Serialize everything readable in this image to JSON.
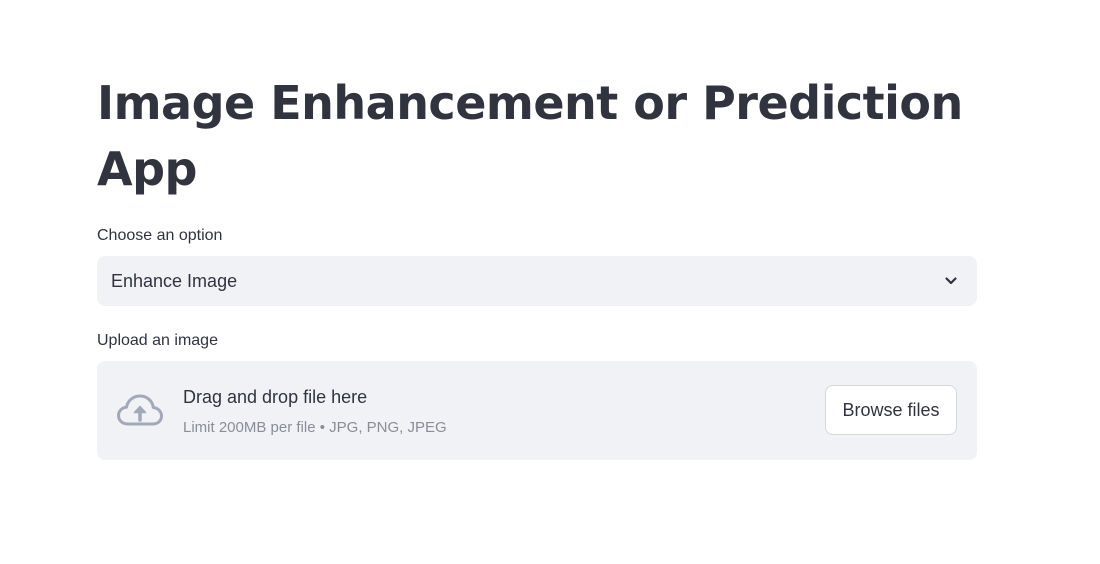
{
  "app": {
    "title": "Image Enhancement or Prediction App"
  },
  "option_select": {
    "label": "Choose an option",
    "selected_value": "Enhance Image",
    "icon": "chevron-down-icon"
  },
  "uploader": {
    "label": "Upload an image",
    "drop_title": "Drag and drop file here",
    "limit_text": "Limit 200MB per file • JPG, PNG, JPEG",
    "browse_label": "Browse files",
    "icon": "cloud-upload-icon"
  },
  "colors": {
    "text": "#31333f",
    "muted_text": "#8b8d96",
    "widget_bg": "#f0f2f6",
    "icon": "#a3a8b8"
  }
}
